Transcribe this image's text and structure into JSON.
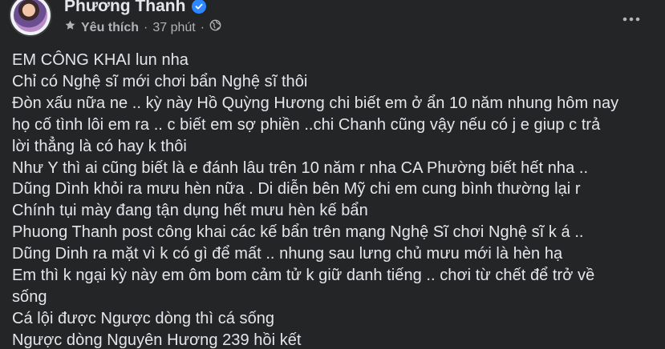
{
  "post": {
    "author_name": "Phương Thanh",
    "verified": true,
    "meta": {
      "favorite_label": "Yêu thích",
      "separator": "·",
      "time": "37 phút",
      "audience_icon": "globe-icon"
    },
    "more_icon": "more-horizontal-icon",
    "body_lines": [
      "EM CÔNG KHAI lun nha",
      "Chỉ có Nghệ sĩ mới chơi bẩn Nghệ sĩ thôi",
      "Đòn xấu nữa ne .. kỳ này Hồ Quỳng Hương chi biết em ở ẩn 10 năm nhung hôm nay",
      "họ cố tình lôi em ra .. c biết em sợ phiền ..chi Chanh cũng vậy nếu có j e giup c trả",
      "lời thẳng là có hay k thôi",
      "Như Y thì ai cũng biết là e đánh lâu trên 10 năm r nha CA Phường biết hết nha ..",
      "Dũng Dình khỏi ra mưu hèn nữa .  Di diễn bên Mỹ chi em cung bình thường lại r",
      "Chính tụi mày đang tận dụng hết mưu hèn kế bẩn",
      "Phuong Thanh post công khai các kế bẩn trên mạng Nghệ Sĩ chơi Nghệ sĩ k á ..",
      "Dũng Dinh ra mặt vì k có gì để mất .. nhung sau lưng chủ mưu mới là hèn hạ",
      "Em thì k ngại kỳ này em ôm bom cảm tử k giữ danh tiếng .. chơi từ chết để trở về",
      "sống",
      "Cá lội được Ngược dòng thì cá sống",
      "Ngược dòng Nguyên Hương 239 hồi kết"
    ]
  },
  "colors": {
    "background": "#242526",
    "text_primary": "#e4e6eb",
    "text_secondary": "#b0b3b8",
    "verified_badge": "#2d88ff"
  }
}
